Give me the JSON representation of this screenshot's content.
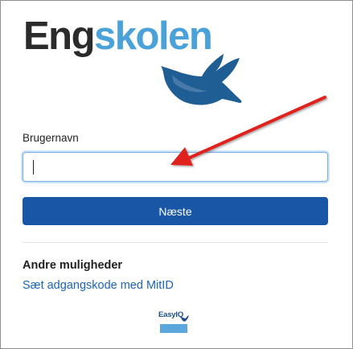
{
  "logo": {
    "part1": "Eng",
    "part2": "skolen",
    "color_dark": "#2b2b2b",
    "color_light": "#4aa2d8"
  },
  "form": {
    "username_label": "Brugernavn",
    "username_value": "",
    "next_label": "Næste"
  },
  "other_options": {
    "heading": "Andre muligheder",
    "mitid_link": "Sæt adgangskode med MitID"
  },
  "footer": {
    "easyiq_label": "EasyIQ"
  },
  "colors": {
    "primary_button": "#1957a6",
    "link": "#1966b8",
    "annotation_arrow": "#e0201f"
  }
}
